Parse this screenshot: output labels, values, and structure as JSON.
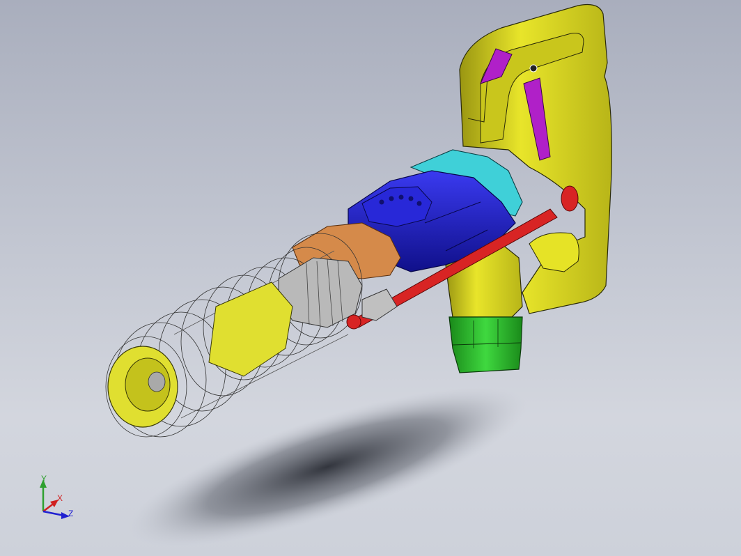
{
  "view": {
    "background_top": "#a9aebd",
    "background_bottom": "#d3d6de"
  },
  "model": {
    "parts": [
      {
        "name": "handle",
        "color": "#e3e020"
      },
      {
        "name": "trigger",
        "color": "#b020c8"
      },
      {
        "name": "motor-housing",
        "color": "#1f1fc8"
      },
      {
        "name": "rear-cap",
        "color": "#3fd0d8"
      },
      {
        "name": "air-tube",
        "color": "#d82424"
      },
      {
        "name": "air-fitting",
        "color": "#2fc02f"
      },
      {
        "name": "copper-ring",
        "color": "#d58a4a"
      },
      {
        "name": "nose-sleeve",
        "color": "#e0df30"
      }
    ]
  },
  "triad": {
    "y_label": "Y",
    "x_label": "X",
    "z_label": "Z",
    "y_color": "#2fa02f",
    "x_color": "#d02020",
    "z_color": "#2020d0"
  }
}
